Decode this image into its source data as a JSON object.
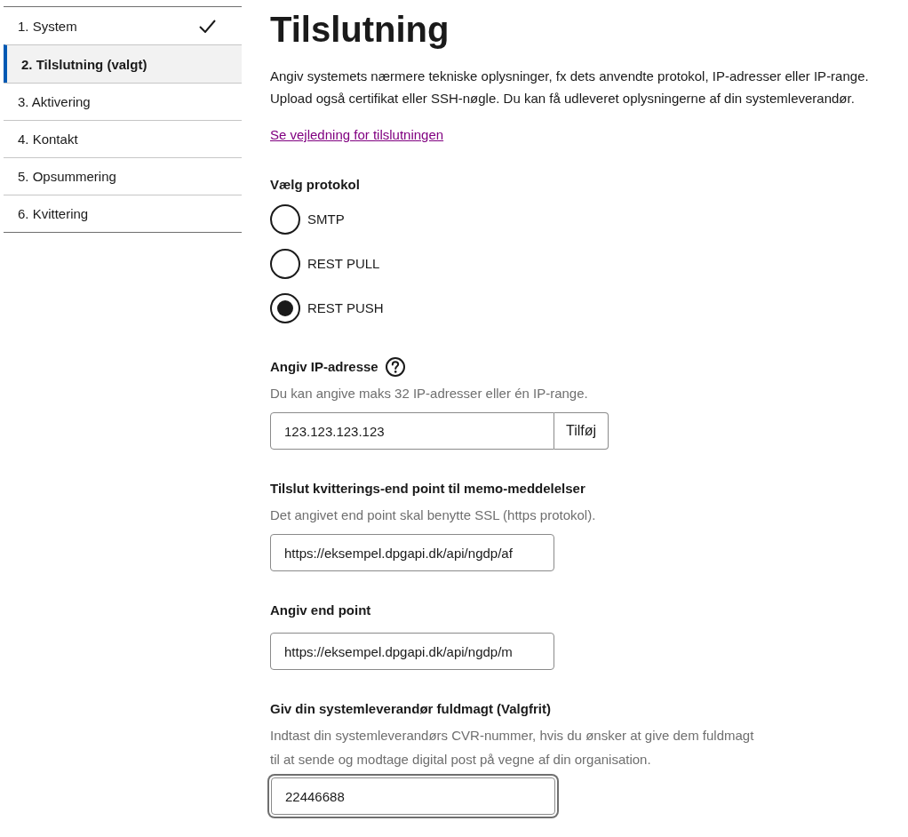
{
  "steps": [
    {
      "label": "1. System",
      "completed": true,
      "selected": false
    },
    {
      "label": "2. Tilslutning (valgt)",
      "completed": false,
      "selected": true
    },
    {
      "label": "3. Aktivering",
      "completed": false,
      "selected": false
    },
    {
      "label": "4. Kontakt",
      "completed": false,
      "selected": false
    },
    {
      "label": "5. Opsummering",
      "completed": false,
      "selected": false
    },
    {
      "label": "6. Kvittering",
      "completed": false,
      "selected": false
    }
  ],
  "page": {
    "title": "Tilslutning",
    "intro": "Angiv systemets nærmere tekniske oplysninger, fx dets anvendte protokol, IP-adresser eller IP-range. Upload også certifikat eller SSH-nøgle. Du kan få udleveret oplysningerne af din systemleverandør.",
    "guide_link": "Se vejledning for tilslutningen"
  },
  "protocol": {
    "label": "Vælg protokol",
    "options": [
      {
        "label": "SMTP",
        "selected": false
      },
      {
        "label": "REST PULL",
        "selected": false
      },
      {
        "label": "REST PUSH",
        "selected": true
      }
    ]
  },
  "ip_address": {
    "label": "Angiv IP-adresse",
    "hint": "Du kan angive maks 32 IP-adresser eller én IP-range.",
    "value": "123.123.123.123",
    "button": "Tilføj"
  },
  "receipt_endpoint": {
    "label": "Tilslut kvitterings-end point til memo-meddelelser",
    "hint": "Det angivet end point skal benytte SSL (https protokol).",
    "value": "https://eksempel.dpgapi.dk/api/ngdp/af"
  },
  "endpoint": {
    "label": "Angiv end point",
    "value": "https://eksempel.dpgapi.dk/api/ngdp/m"
  },
  "proxy": {
    "label": "Giv din systemleverandør fuldmagt (Valgfrit)",
    "hint": "Indtast din systemleverandørs CVR-nummer, hvis du ønsker at give dem fuldmagt til at sende og modtage digital post på vegne af din organisation.",
    "value": "22446688",
    "focused": true
  }
}
